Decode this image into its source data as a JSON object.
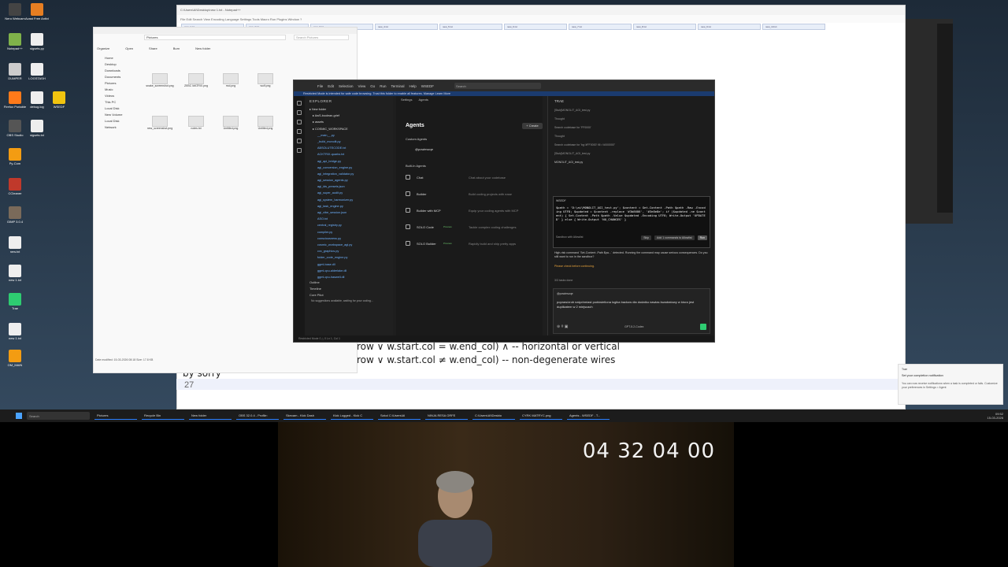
{
  "desktop_icons": [
    {
      "label": "Nero Webcam"
    },
    {
      "label": "Avast Free Antivirus"
    },
    {
      "label": "Notepad++"
    },
    {
      "label": "sigsets.py"
    },
    {
      "label": "DUMPER"
    },
    {
      "label": "LOGSTASH"
    },
    {
      "label": "Firefox Portable"
    },
    {
      "label": "debug.log"
    },
    {
      "label": "WSEDF"
    },
    {
      "label": "OBS Studio"
    },
    {
      "label": "sigsets.txt"
    },
    {
      "label": "Py-Com"
    },
    {
      "label": "CCleaner"
    },
    {
      "label": "GIMP 3.0.4"
    },
    {
      "label": "new.txt"
    },
    {
      "label": "new 1.txt"
    },
    {
      "label": "Trae"
    },
    {
      "label": "new 1.txt"
    },
    {
      "label": "OM_MAIN"
    }
  ],
  "notepad": {
    "title": "C:\\Users\\AI\\Desktop\\new 1.txt - Notepad++",
    "menu": "File  Edit  Search  View  Encoding  Language  Settings  Tools  Macro  Run  Plugins  Window  ?",
    "tabs": [
      "new_1.txt",
      "new_2.txt",
      "new_3.txt",
      "new_4.txt",
      "new_5.txt",
      "new_6.txt",
      "new_7.txt",
      "new_8.txt",
      "new_9.txt",
      "new_10.txt"
    ],
    "code_line_1": "row ∨ w.start.col = w.end_col) ∧  -- horizontal or vertical",
    "code_line_2": "row ∨ w.start.col ≠ w.end_col) -- non-degenerate wires",
    "code_line_3": "by sorry",
    "line_number": "27"
  },
  "explorer": {
    "address": "Pictures",
    "search_placeholder": "Search Pictures",
    "toolbar": [
      "Organize",
      "Open",
      "Share",
      "Burn",
      "New folder"
    ],
    "nav": [
      "Home",
      "Desktop",
      "Downloads",
      "Documents",
      "Pictures",
      "Music",
      "Videos",
      "This PC",
      "Local Disk",
      "New Volume",
      "Local Disk",
      "Network"
    ],
    "files": [
      "snake_screenshot.png",
      "ZEBC MATRIX.png",
      "mol.png",
      "wolf.png",
      "new_screenshot.png",
      "notes.txt",
      "Untitled.png",
      "Untitled.png"
    ],
    "status": "Date modified: 15-03-2026 08:18    Size: 17.8 KB"
  },
  "ide": {
    "menu": [
      "File",
      "Edit",
      "Selection",
      "View",
      "Go",
      "Run",
      "Terminal",
      "Help",
      "WSEDF"
    ],
    "search_placeholder": "Search",
    "restricted_banner": "Restricted Mode is intended for safe code browsing. Trust this folder to enable all features.  Manage  Learn More",
    "explorer_header": "EXPLORER",
    "tree": [
      {
        "name": "New folder",
        "folder": true
      },
      {
        "name": "AwS-boolean-grief",
        "folder": true
      },
      {
        "name": "assets",
        "folder": true
      },
      {
        "name": "COSMIC_WORKSPACE",
        "folder": true
      },
      {
        "name": "__main__.py",
        "folder": false
      },
      {
        "name": "_build_monolit.py",
        "folder": false
      },
      {
        "name": "ABSOLUTECODE.txt",
        "folder": false
      },
      {
        "name": "ACKTRIX-quarks.txt",
        "folder": false
      },
      {
        "name": "agi_api_bridge.py",
        "folder": false
      },
      {
        "name": "agi_conversion_engine.py",
        "folder": false
      },
      {
        "name": "agi_integration_validator.py",
        "folder": false
      },
      {
        "name": "agi_session_agents.py",
        "folder": false
      },
      {
        "name": "agi_ids_presets.json",
        "folder": false
      },
      {
        "name": "agi_super_audit.py",
        "folder": false
      },
      {
        "name": "agi_system_harmonizer.py",
        "folder": false
      },
      {
        "name": "agi_task_engine.py",
        "folder": false
      },
      {
        "name": "agi_vibe_session.json",
        "folder": false
      },
      {
        "name": "ASO.txt",
        "folder": false
      },
      {
        "name": "central_registry.py",
        "folder": false
      },
      {
        "name": "compiler.py",
        "folder": false
      },
      {
        "name": "consciousness.py",
        "folder": false
      },
      {
        "name": "cosmic_workspace_agi.py",
        "folder": false
      },
      {
        "name": "cvc_graphics.py",
        "folder": false
      },
      {
        "name": "folder_code_engine.py",
        "folder": false
      },
      {
        "name": "ggml-base.dll",
        "folder": false
      },
      {
        "name": "ggml-cpu-alderlake.dll",
        "folder": false
      },
      {
        "name": "ggml-cpu-haswell.dll",
        "folder": false
      }
    ],
    "outline": "Outline",
    "timeline": "Timeline",
    "corepilot": "Core Pilot",
    "corepilot_msg": "No suggestions available, waiting for your coding...",
    "statusbar": "Restricted Mode    0 △ 0    Ln 1, Col 1",
    "agents_tabs": [
      "Settings",
      "Agents"
    ],
    "agents_title": "Agents",
    "create_label": "+ Create",
    "custom_agents_label": "Custom Agents",
    "custom_agent": "@powieszqe",
    "builtin_label": "Built-In Agents",
    "builtin_agents": [
      {
        "name": "Chat",
        "badge": "",
        "desc": "Chat about your codebase"
      },
      {
        "name": "Builder",
        "badge": "",
        "desc": "Build coding projects with ease"
      },
      {
        "name": "Builder with MCP",
        "badge": "",
        "desc": "Equip your coding agents with MCP"
      },
      {
        "name": "SOLO Code",
        "badge": "Preview",
        "desc": "Tackle complex coding challenges"
      },
      {
        "name": "SOLO Builder",
        "badge": "Preview",
        "desc": "Rapidly build and ship pretty apps"
      }
    ],
    "chat": {
      "header": "TRAE",
      "log": [
        "[Stub]MONOLIT_AGI_test.py",
        "Thought",
        "Search codebase for 'FF0000'",
        "Thought",
        "Search codebase for 'bg:'#FF0000' fill ='#000000''",
        "[Stub]MONOLIT_AGI_test.py"
      ],
      "edit_file": "MONOLIT_AGI_test.py",
      "terminal_title": "WSEDF",
      "terminal_cmd": "$path = 'D:\\ai\\MONOLIT_AGI_test.py'; $content = Get-Content -Path $path -Raw -Encoding UTF8; $updated = $content -replace '#3b8686', '#3e8e8e'; if ($updated -ne $content) { Set-Content -Path $path -Value $updated -Encoding UTF8; Write-Output 'UPDATED' } else { Write-Output 'NO_CHANGES' }",
      "sandbox_label": "Sandbox with Allowlist",
      "skip_label": "Skip",
      "allowlist_label": "Add 1 commands to Allowlist",
      "run_label": "Run",
      "warning": "High-risk command `Set-Content -Path $pa...` detected. Running the command may cause serious consequences. Do you still want to run in the sandbox?",
      "review": "Please check before continuing.",
      "tasks": "3/3 tasks done",
      "mention": "@powieszqe",
      "input_text": "popraw/zrob natychmiast podświetlona logika backow dla dodatku nawias kwadratowy w ktora jest duplikatem w 2 miejscach",
      "model": "GPT-5.2-Codex"
    }
  },
  "toast": {
    "title": "Trae",
    "heading": "Set your completion notification",
    "message": "You can now receive notifications when a task is completed or fails. Customize your preferences in Settings > Agent"
  },
  "taskbar": {
    "search_placeholder": "Search",
    "items": [
      "Pictures",
      "Recycle Bin",
      "New folder",
      "OBS 32.0.4 - Profile:",
      "Skecam - Kick Dash",
      "Kick Logged - Kick C",
      "Szkol C:\\Users\\AI",
      "NINJA RESA ORFE",
      "C:\\Users\\AI\\Deskto",
      "CYRK MATRYC.png",
      "Agents - WSEDF - T..."
    ],
    "time": "09:52",
    "date": "15-03-2026"
  },
  "webcam": {
    "counter": "04 32 04 00"
  },
  "colors": {
    "accent": "#2b7fff",
    "send": "#2ecc71",
    "ide_bg": "#1e1e1e",
    "restricted_banner": "#1b3b6f"
  }
}
